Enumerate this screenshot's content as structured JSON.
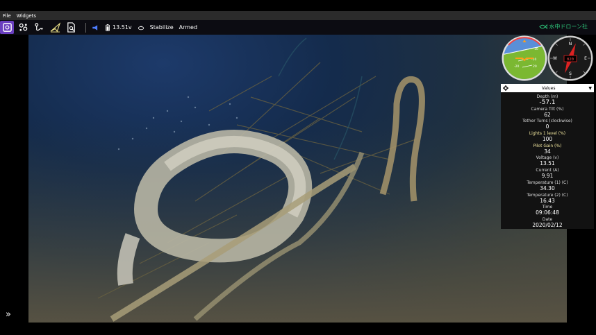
{
  "menu": {
    "items": [
      "File",
      "Widgets"
    ]
  },
  "toolbar": {
    "voltage": "13.51v",
    "mode": "Stabilize",
    "arm_state": "Armed",
    "brand": "水中ドローン社",
    "icons": [
      "view-icon",
      "gamepad-icon",
      "map-route-icon",
      "paper-plane-icon",
      "document-search-icon",
      "megaphone-icon",
      "battery-icon",
      "vehicle-icon"
    ]
  },
  "instruments": {
    "compass": {
      "heading": "020",
      "n": "N",
      "e": "E",
      "s": "S",
      "w": "W"
    },
    "attitude": {
      "scale": [
        "10",
        "-10",
        "20",
        "-20"
      ]
    }
  },
  "values_panel": {
    "title": "Values",
    "items": [
      {
        "label": "Depth (m)",
        "value": "-57.1"
      },
      {
        "label": "Camera Tilt (%)",
        "value": "62"
      },
      {
        "label": "Tether Turns (clockwise)",
        "value": "0"
      },
      {
        "label": "Lights 1 level (%)",
        "value": "100"
      },
      {
        "label": "Pilot Gain (%)",
        "value": "34"
      },
      {
        "label": "Voltage (v)",
        "value": "13.51"
      },
      {
        "label": "Current (A)",
        "value": "9.91"
      },
      {
        "label": "Temperature (1) (C)",
        "value": "34.30"
      },
      {
        "label": "Temperature (2) (C)",
        "value": "16.43"
      },
      {
        "label": "Time",
        "value": "09:06:48"
      },
      {
        "label": "Date",
        "value": "2020/02/12"
      }
    ]
  },
  "colors": {
    "accent": "#6a3fbf",
    "brand": "#2ec47a",
    "attitude_ground": "#7bb832",
    "attitude_sky": "#5a8fd8"
  }
}
